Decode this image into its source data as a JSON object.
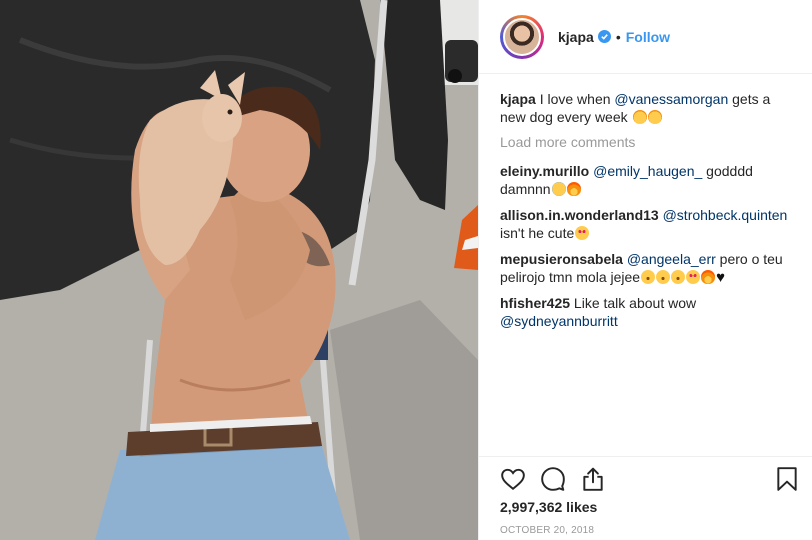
{
  "post": {
    "username": "kjapa",
    "separator": "•",
    "follow_label": "Follow",
    "caption": {
      "user": "kjapa",
      "text_before": " I love when ",
      "mention": "@vanessamorgan",
      "text_after": " gets a new dog every week "
    },
    "load_more_label": "Load more comments",
    "comments": [
      {
        "user": "eleiny.murillo",
        "mention": "@emily_haugen_",
        "text": " godddd damnnn"
      },
      {
        "user": "allison.in.wonderland13",
        "mention": "@strohbeck.quinten",
        "text": " isn't he cute"
      },
      {
        "user": "mepusieronsabela",
        "mention": "@angeela_err",
        "text": " pero o teu pelirojo tmn mola jejee"
      },
      {
        "user": "hfisher425",
        "text": " Like talk about wow ",
        "mention": "@sydneyannburritt"
      }
    ],
    "likes": "2,997,362 likes",
    "date": "OCTOBER 20, 2018"
  },
  "icons": {
    "avatar": "profile-picture",
    "verified": "verified-badge-icon",
    "like": "heart-outline-icon",
    "comment": "comment-bubble-icon",
    "share": "share-upload-icon",
    "save": "bookmark-icon"
  },
  "colors": {
    "link": "#3897f0",
    "mention": "#003569",
    "muted": "#999999",
    "border": "#efefef"
  }
}
